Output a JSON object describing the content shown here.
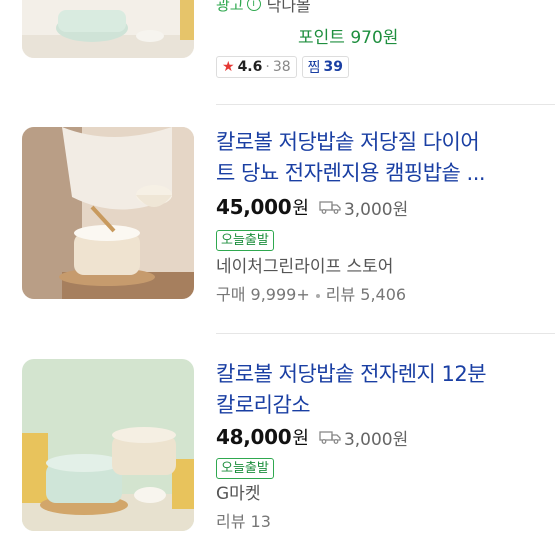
{
  "colors": {
    "link": "#1a3fa3",
    "badge_green": "#1f8f3f",
    "star": "#e53935"
  },
  "top_item": {
    "ad_label": "광고",
    "store": "닥나몰",
    "points": "포인트 970원",
    "rating": "4.6",
    "review_count": "38",
    "zzim_label": "찜",
    "zzim_count": "39"
  },
  "items": [
    {
      "title_line1": "칼로볼 저당밥솥 저당질 다이어",
      "title_line2": "트 당뇨 전자렌지용 캠핑밥솥 ...",
      "price": "45,000",
      "price_unit": "원",
      "shipping": "3,000원",
      "badge": "오늘출발",
      "store": "네이처그린라이프 스토어",
      "purchase": "구매 9,999+",
      "reviews": "리뷰 5,406"
    },
    {
      "title_line1": "칼로볼 저당밥솥 전자렌지 12분",
      "title_line2": "칼로리감소",
      "price": "48,000",
      "price_unit": "원",
      "shipping": "3,000원",
      "badge": "오늘출발",
      "store": "G마켓",
      "reviews": "리뷰 13"
    }
  ]
}
